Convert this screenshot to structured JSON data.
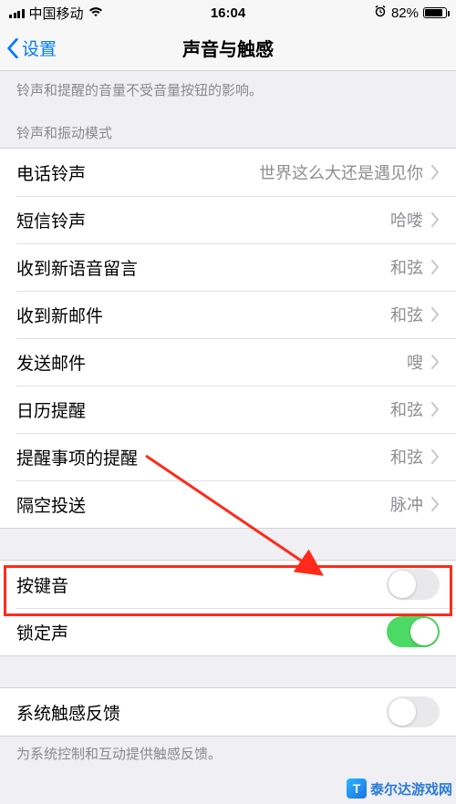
{
  "status": {
    "carrier": "中国移动",
    "time": "16:04",
    "battery_pct": "82%"
  },
  "nav": {
    "back": "设置",
    "title": "声音与触感"
  },
  "notes": {
    "volume": "铃声和提醒的音量不受音量按钮的影响。",
    "section_sounds": "铃声和振动模式",
    "haptic_footer": "为系统控制和互动提供触感反馈。"
  },
  "rows": {
    "ringtone": {
      "label": "电话铃声",
      "value": "世界这么大还是遇见你"
    },
    "text": {
      "label": "短信铃声",
      "value": "哈喽"
    },
    "voicemail": {
      "label": "收到新语音留言",
      "value": "和弦"
    },
    "newmail": {
      "label": "收到新邮件",
      "value": "和弦"
    },
    "sentmail": {
      "label": "发送邮件",
      "value": "嗖"
    },
    "calendar": {
      "label": "日历提醒",
      "value": "和弦"
    },
    "reminders": {
      "label": "提醒事项的提醒",
      "value": "和弦"
    },
    "airdrop": {
      "label": "隔空投送",
      "value": "脉冲"
    }
  },
  "toggles": {
    "keyclicks": {
      "label": "按键音",
      "on": false
    },
    "locksound": {
      "label": "锁定声",
      "on": true
    },
    "haptics": {
      "label": "系统触感反馈",
      "on": false
    }
  },
  "watermark": "泰尔达游戏网"
}
